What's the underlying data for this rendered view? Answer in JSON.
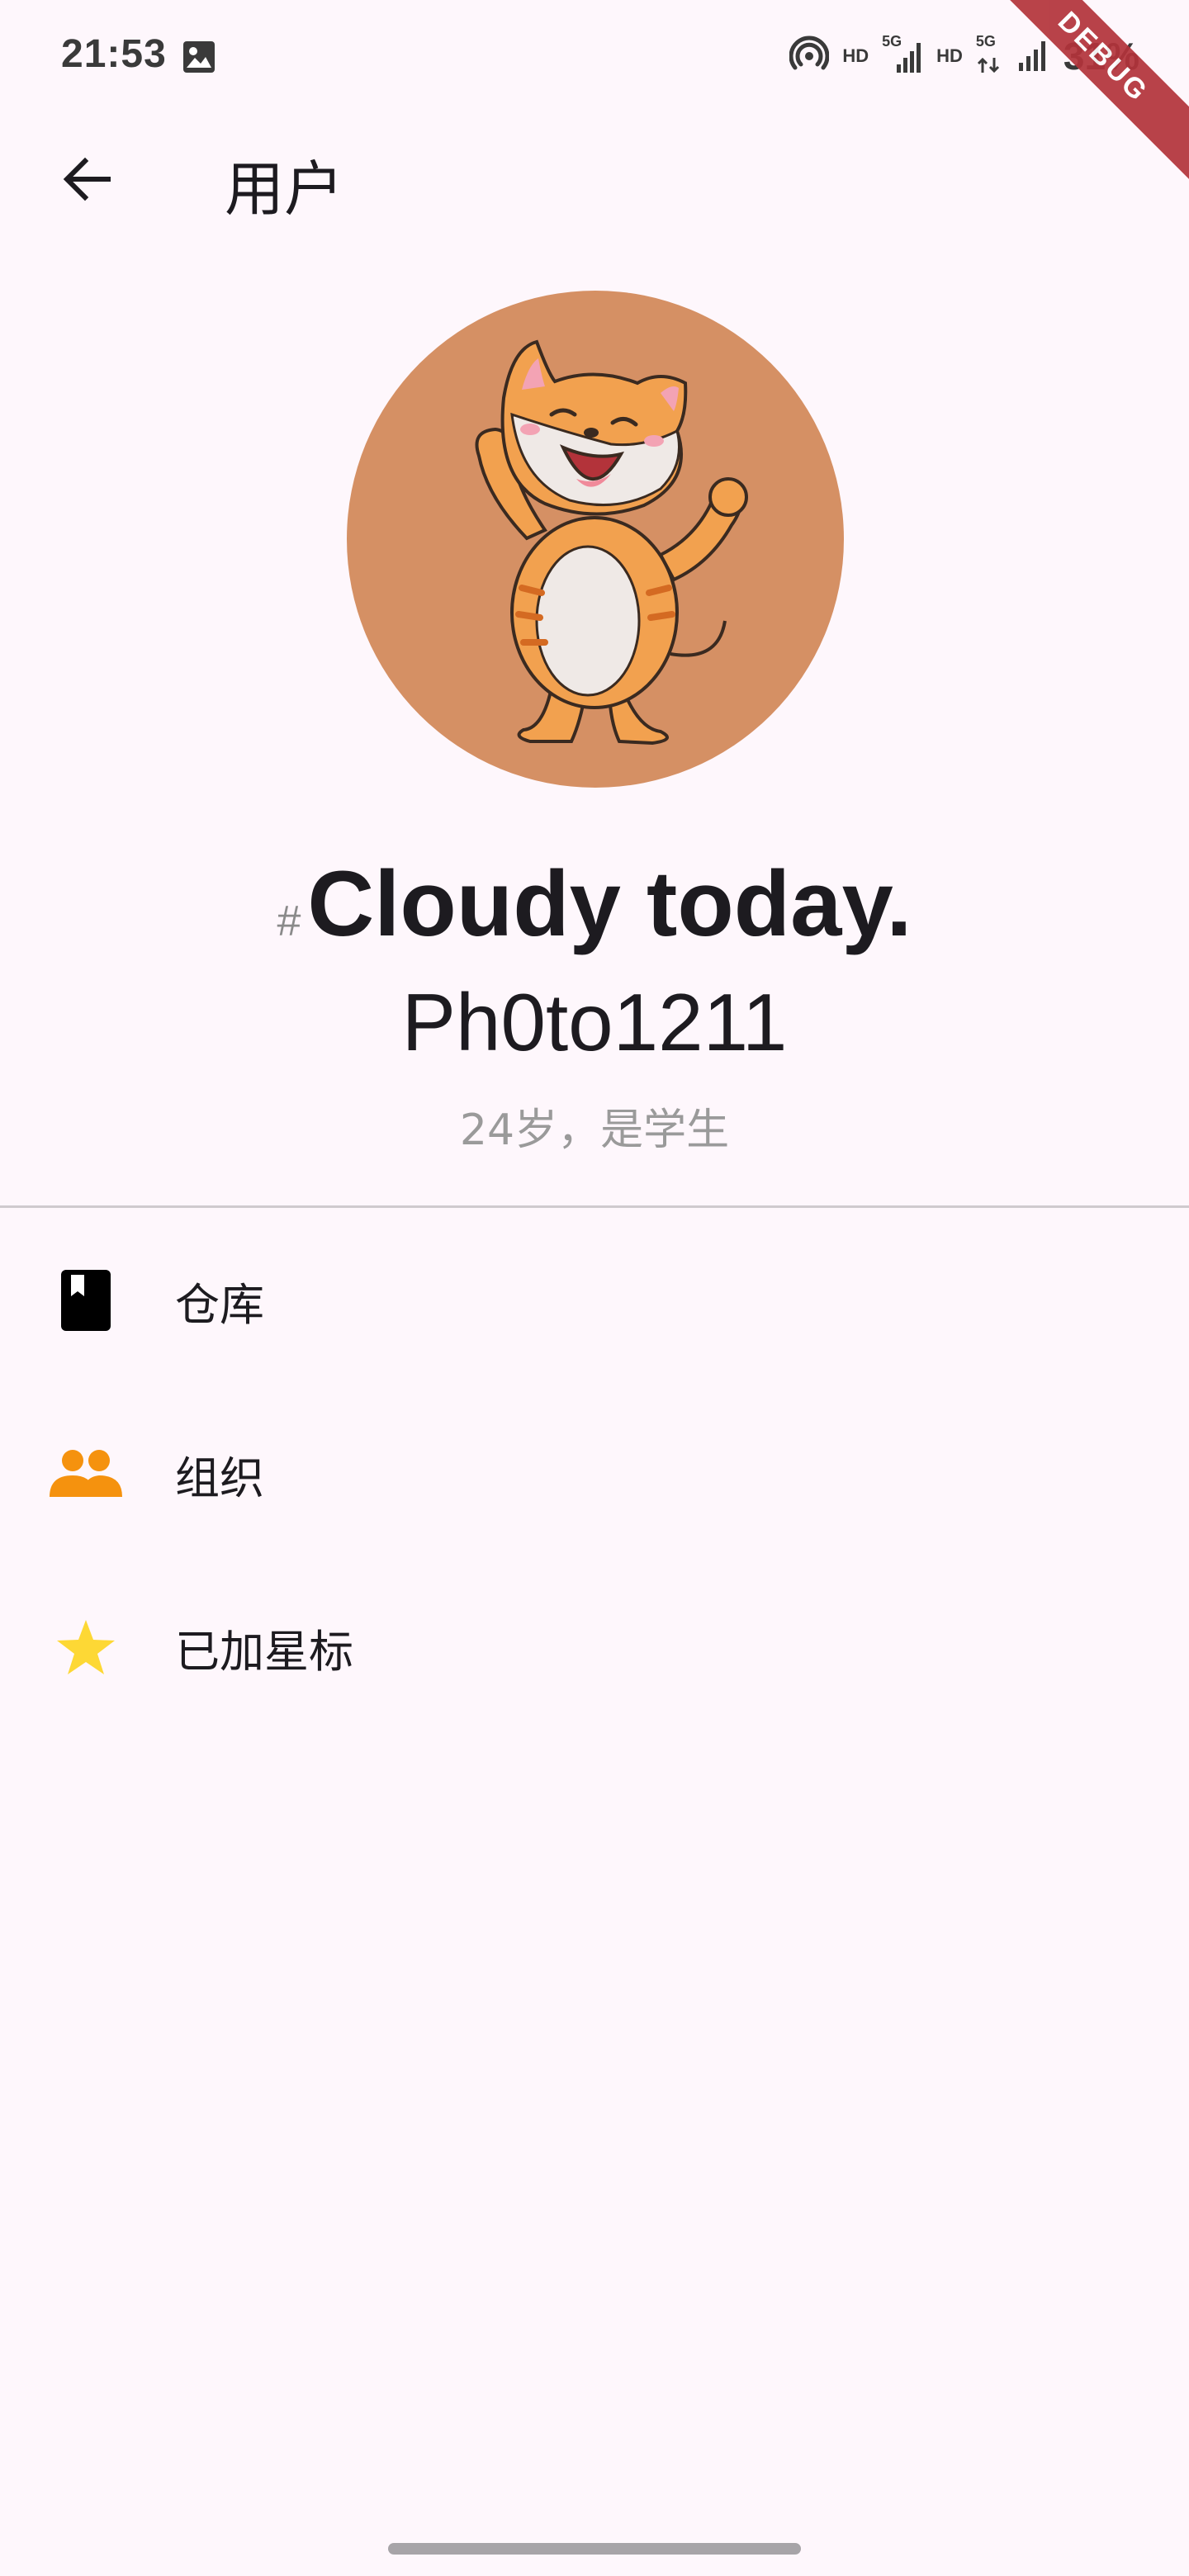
{
  "status_bar": {
    "time": "21:53",
    "hd_1": "HD",
    "hd_2": "HD",
    "signal_1_label": "5G",
    "signal_2_label": "5G",
    "battery": "31%",
    "icons": [
      "image-icon",
      "hotspot-icon",
      "signal-icon",
      "signal-icon",
      "battery-icon"
    ]
  },
  "debug_banner": "DEBUG",
  "app_bar": {
    "title": "用户",
    "back_icon": "arrow-back-icon"
  },
  "profile": {
    "hash_symbol": "#",
    "motto": "Cloudy today.",
    "username": "Ph0to1211",
    "bio": "24岁，是学生",
    "avatar_bg": "#d59064"
  },
  "menu": {
    "items": [
      {
        "label": "仓库",
        "icon": "book-icon",
        "icon_color": "#000000"
      },
      {
        "label": "组织",
        "icon": "people-icon",
        "icon_color": "#f5920e"
      },
      {
        "label": "已加星标",
        "icon": "star-icon",
        "icon_color": "#fdd835"
      }
    ]
  },
  "colors": {
    "background": "#fef7fc",
    "debug_ribbon": "#b3333a",
    "divider": "#cfcace"
  }
}
